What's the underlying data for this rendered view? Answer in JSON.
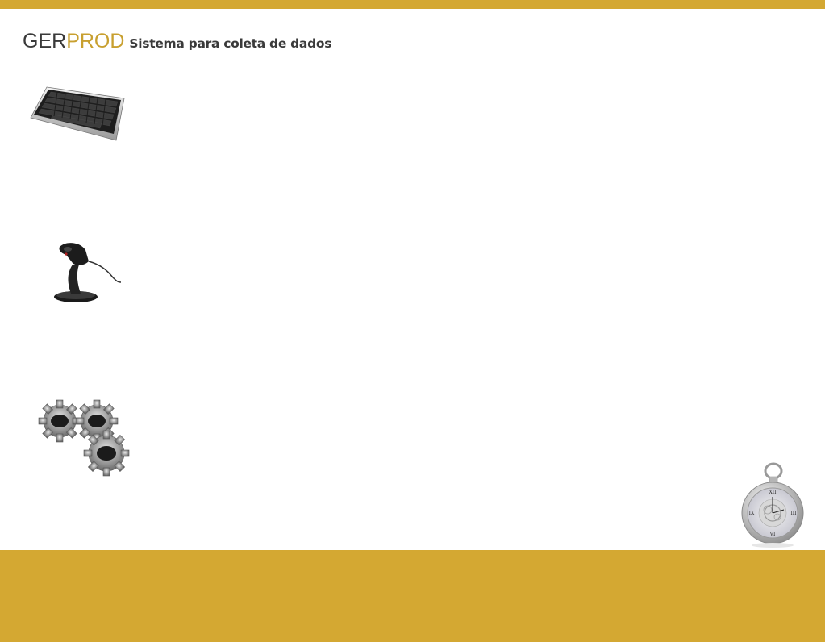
{
  "header": {
    "logo_part1": "GER",
    "logo_part2": "PROD",
    "subtitle": "Sistema para coleta de dados"
  },
  "colors": {
    "accent": "#d4a832",
    "logo_gold": "#c8a030",
    "logo_dark": "#3a3a3a"
  },
  "icons": [
    "keyboard-icon",
    "barcode-scanner-icon",
    "gears-icon",
    "pocket-watch-icon"
  ]
}
